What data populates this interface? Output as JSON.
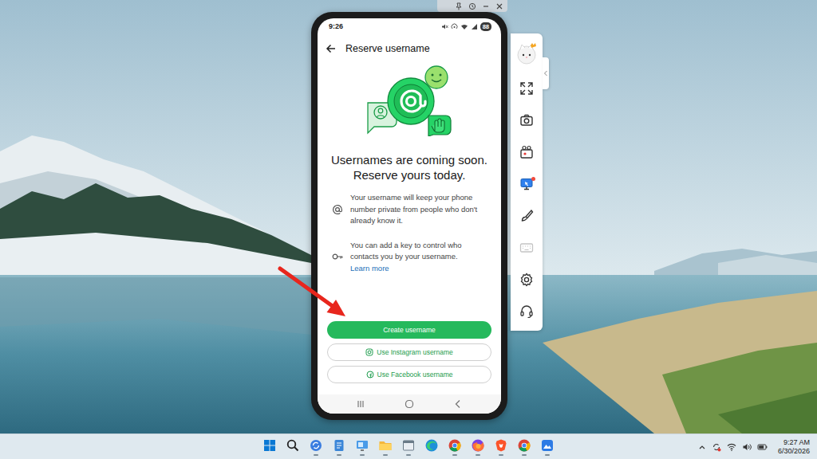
{
  "phone": {
    "status_bar": {
      "time": "9:26",
      "battery": "88"
    },
    "header": {
      "title": "Reserve username"
    },
    "hero": {
      "title_lines": [
        "Usernames are coming soon.",
        "Reserve yours today."
      ]
    },
    "features": [
      {
        "text": "Your username will keep your phone number private from people who don't already know it."
      },
      {
        "text": "You can add a key to control who contacts you by your username.",
        "link": "Learn more"
      }
    ],
    "buttons": [
      {
        "label": "Create username",
        "kind": "primary"
      },
      {
        "label": "Use Instagram username",
        "kind": "instagram"
      },
      {
        "label": "Use Facebook username",
        "kind": "facebook"
      }
    ]
  },
  "toolbar": {
    "items": [
      {
        "disabled": false,
        "badge": false
      },
      {
        "disabled": false,
        "badge": false
      },
      {
        "disabled": false,
        "badge": false
      },
      {
        "disabled": false,
        "badge": true
      },
      {
        "disabled": false,
        "badge": false
      },
      {
        "disabled": true,
        "badge": false
      },
      {
        "disabled": false,
        "badge": false
      },
      {
        "disabled": false,
        "badge": false
      }
    ]
  },
  "taskbar": {
    "apps": [
      {
        "running": false
      },
      {
        "running": false
      },
      {
        "running": true
      },
      {
        "running": true
      },
      {
        "running": true
      },
      {
        "running": true
      },
      {
        "running": true
      },
      {
        "running": false
      },
      {
        "running": true
      },
      {
        "running": true
      },
      {
        "running": true
      },
      {
        "running": true
      },
      {
        "running": true
      }
    ],
    "clock": {
      "time": "9:27 AM",
      "date": "6/30/2026"
    }
  }
}
